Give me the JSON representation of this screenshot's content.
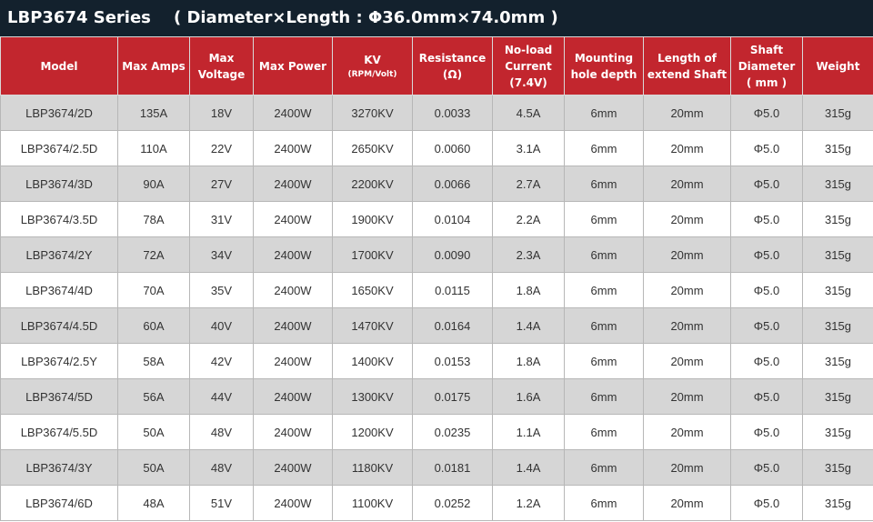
{
  "title": "LBP3674 Series    ( Diameter×Length : Φ36.0mm×74.0mm )",
  "headers": [
    {
      "line1": "Model",
      "line2": "",
      "line3": ""
    },
    {
      "line1": "Max Amps",
      "line2": "",
      "line3": ""
    },
    {
      "line1": "Max",
      "line2": "Voltage",
      "line3": ""
    },
    {
      "line1": "Max Power",
      "line2": "",
      "line3": ""
    },
    {
      "line1": "KV",
      "line2": "",
      "line3": "(RPM/Volt)"
    },
    {
      "line1": "Resistance",
      "line2": "(Ω)",
      "line3": ""
    },
    {
      "line1": "No-load",
      "line2": "Current",
      "line3": "(7.4V)"
    },
    {
      "line1": "Mounting",
      "line2": "hole depth",
      "line3": ""
    },
    {
      "line1": "Length of",
      "line2": "extend Shaft",
      "line3": ""
    },
    {
      "line1": "Shaft",
      "line2": "Diameter",
      "line3": "( mm )"
    },
    {
      "line1": "Weight",
      "line2": "",
      "line3": ""
    }
  ],
  "rows": [
    [
      "LBP3674/2D",
      "135A",
      "18V",
      "2400W",
      "3270KV",
      "0.0033",
      "4.5A",
      "6mm",
      "20mm",
      "Φ5.0",
      "315g"
    ],
    [
      "LBP3674/2.5D",
      "110A",
      "22V",
      "2400W",
      "2650KV",
      "0.0060",
      "3.1A",
      "6mm",
      "20mm",
      "Φ5.0",
      "315g"
    ],
    [
      "LBP3674/3D",
      "90A",
      "27V",
      "2400W",
      "2200KV",
      "0.0066",
      "2.7A",
      "6mm",
      "20mm",
      "Φ5.0",
      "315g"
    ],
    [
      "LBP3674/3.5D",
      "78A",
      "31V",
      "2400W",
      "1900KV",
      "0.0104",
      "2.2A",
      "6mm",
      "20mm",
      "Φ5.0",
      "315g"
    ],
    [
      "LBP3674/2Y",
      "72A",
      "34V",
      "2400W",
      "1700KV",
      "0.0090",
      "2.3A",
      "6mm",
      "20mm",
      "Φ5.0",
      "315g"
    ],
    [
      "LBP3674/4D",
      "70A",
      "35V",
      "2400W",
      "1650KV",
      "0.0115",
      "1.8A",
      "6mm",
      "20mm",
      "Φ5.0",
      "315g"
    ],
    [
      "LBP3674/4.5D",
      "60A",
      "40V",
      "2400W",
      "1470KV",
      "0.0164",
      "1.4A",
      "6mm",
      "20mm",
      "Φ5.0",
      "315g"
    ],
    [
      "LBP3674/2.5Y",
      "58A",
      "42V",
      "2400W",
      "1400KV",
      "0.0153",
      "1.8A",
      "6mm",
      "20mm",
      "Φ5.0",
      "315g"
    ],
    [
      "LBP3674/5D",
      "56A",
      "44V",
      "2400W",
      "1300KV",
      "0.0175",
      "1.6A",
      "6mm",
      "20mm",
      "Φ5.0",
      "315g"
    ],
    [
      "LBP3674/5.5D",
      "50A",
      "48V",
      "2400W",
      "1200KV",
      "0.0235",
      "1.1A",
      "6mm",
      "20mm",
      "Φ5.0",
      "315g"
    ],
    [
      "LBP3674/3Y",
      "50A",
      "48V",
      "2400W",
      "1180KV",
      "0.0181",
      "1.4A",
      "6mm",
      "20mm",
      "Φ5.0",
      "315g"
    ],
    [
      "LBP3674/6D",
      "48A",
      "51V",
      "2400W",
      "1100KV",
      "0.0252",
      "1.2A",
      "6mm",
      "20mm",
      "Φ5.0",
      "315g"
    ]
  ]
}
